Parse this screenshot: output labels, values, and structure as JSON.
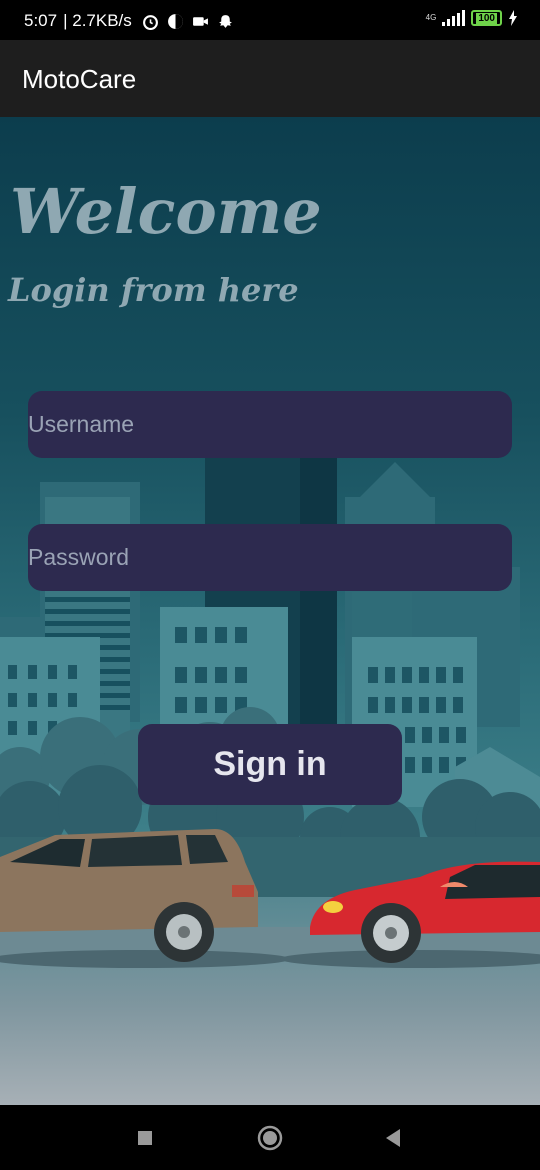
{
  "status_bar": {
    "time": "5:07",
    "speed": "| 2.7KB/s",
    "network": "4G",
    "battery": "100"
  },
  "app_bar": {
    "title": "MotoCare"
  },
  "login": {
    "welcome": "Welcome",
    "subtitle": "Login from here",
    "username_placeholder": "Username",
    "password_placeholder": "Password",
    "sign_in_label": "Sign in"
  },
  "colors": {
    "field_bg": "#2d2a4f",
    "app_bar_bg": "#1e1e1e",
    "title_text": "#8fa8b2"
  }
}
